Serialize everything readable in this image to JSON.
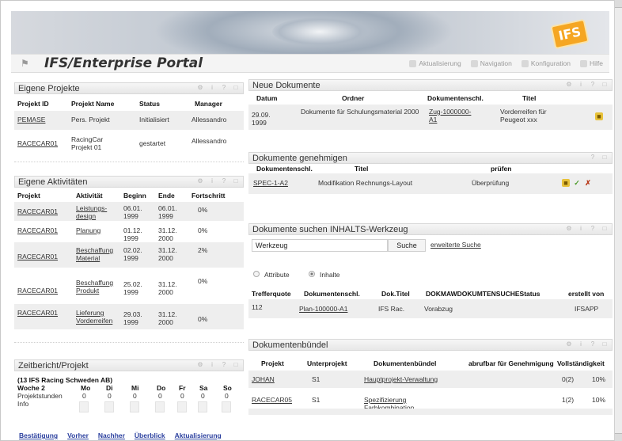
{
  "header": {
    "title": "IFS/Enterprise Portal",
    "nav": [
      {
        "label": "Aktualisierung",
        "icon": "refresh-icon"
      },
      {
        "label": "Navigation",
        "icon": "navigation-icon"
      },
      {
        "label": "Konfiguration",
        "icon": "config-icon"
      },
      {
        "label": "Hilfe",
        "icon": "help-icon"
      }
    ],
    "logo_text": "IFS"
  },
  "eigene_projekte": {
    "title": "Eigene Projekte",
    "columns": [
      "Projekt ID",
      "Projekt Name",
      "Status",
      "Manager"
    ],
    "rows": [
      {
        "id": "PEMASE",
        "name": "Pers. Projekt",
        "status": "Initialisiert",
        "manager": "Allessandro"
      },
      {
        "id": "RACECAR01",
        "name": "RacingCar Projekt 01",
        "status": "gestartet",
        "manager": "Allessandro"
      }
    ]
  },
  "eigene_aktivitaeten": {
    "title": "Eigene Aktivitäten",
    "columns": [
      "Projekt",
      "Aktivität",
      "Beginn",
      "Ende",
      "Fortschritt"
    ],
    "rows": [
      {
        "projekt": "RACECAR01",
        "aktivitaet": "Leistungs-design",
        "beginn": "06.01. 1999",
        "ende": "06.01. 1999",
        "fortschritt": "0%"
      },
      {
        "projekt": "RACECAR01",
        "aktivitaet": "Planung",
        "beginn": "01.12. 1999",
        "ende": "31.12. 2000",
        "fortschritt": "0%"
      },
      {
        "projekt": "RACECAR01",
        "aktivitaet": "Beschaffung Material",
        "beginn": "02.02. 1999",
        "ende": "31.12. 2000",
        "fortschritt": "2%"
      },
      {
        "projekt": "RACECAR01",
        "aktivitaet": "Beschaffung Produkt",
        "beginn": "25.02. 1999",
        "ende": "31.12. 2000",
        "fortschritt": "0%"
      },
      {
        "projekt": "RACECAR01",
        "aktivitaet": "Lieferung Vorderreifen",
        "beginn": "29.03. 1999",
        "ende": "31.12. 2000",
        "fortschritt": "0%"
      }
    ]
  },
  "zeitbericht": {
    "title": "Zeitbericht/Projekt",
    "subtitle": "(13 IFS Racing Schweden AB)",
    "week": "Woche 2",
    "days": [
      "Mo",
      "Di",
      "Mi",
      "Do",
      "Fr",
      "Sa",
      "So"
    ],
    "row_label": "Projektstunden",
    "values": [
      "0",
      "0",
      "0",
      "0",
      "0",
      "0",
      "0"
    ],
    "info_label": "Info",
    "actions": [
      "Bestätigung",
      "Vorher",
      "Nachher",
      "Überblick",
      "Aktualisierung"
    ]
  },
  "neue_dokumente": {
    "title": "Neue Dokumente",
    "columns": [
      "Datum",
      "Ordner",
      "Dokumentenschl.",
      "Titel"
    ],
    "rows": [
      {
        "datum": "29.09. 1999",
        "ordner": "Dokumente für Schulungsmaterial 2000",
        "schluessel": "Zug-1000000-A1",
        "titel": "Vorderreifen für Peugeot xxx"
      }
    ]
  },
  "dokumente_genehmigen": {
    "title": "Dokumente genehmigen",
    "columns": [
      "Dokumentenschl.",
      "Titel",
      "prüfen"
    ],
    "rows": [
      {
        "schluessel": "SPEC-1-A2",
        "titel": "Modifikation Rechnungs-Layout",
        "pruefen": "Überprüfung"
      }
    ]
  },
  "dokumente_suchen": {
    "title": "Dokumente suchen INHALTS-Werkzeug",
    "input_value": "Werkzeug",
    "search_button": "Suche",
    "advanced_link": "erweiterte Suche",
    "radio_attribute": "Attribute",
    "radio_inhalte": "Inhalte",
    "columns": [
      "Trefferquote",
      "Dokumentenschl.",
      "Dok.Titel",
      "DOKMAWDOKUMTENSUCHEStatus",
      "erstellt von"
    ],
    "rows": [
      {
        "quote": "112",
        "schluessel": "Plan-100000-A1",
        "titel": "IFS Rac.",
        "status": "Vorabzug",
        "von": "IFSAPP"
      }
    ]
  },
  "dokumentenbuendel": {
    "title": "Dokumentenbündel",
    "columns": [
      "Projekt",
      "Unterprojekt",
      "Dokumentenbündel",
      "abrufbar für Genehmigung",
      "Vollständigkeit"
    ],
    "rows": [
      {
        "projekt": "JOHAN",
        "unter": "S1",
        "buendel": "Hauptprojekt-Verwaltung",
        "abrufbar": "0(2)",
        "voll": "10%"
      },
      {
        "projekt": "RACECAR05",
        "unter": "S1",
        "buendel": "Spezifizierung Farbkombination",
        "abrufbar": "1(2)",
        "voll": "10%"
      }
    ]
  },
  "colors": {
    "link": "#2a3f9e",
    "visited_link": "#7a2a8e",
    "logo": "#f5a623"
  }
}
